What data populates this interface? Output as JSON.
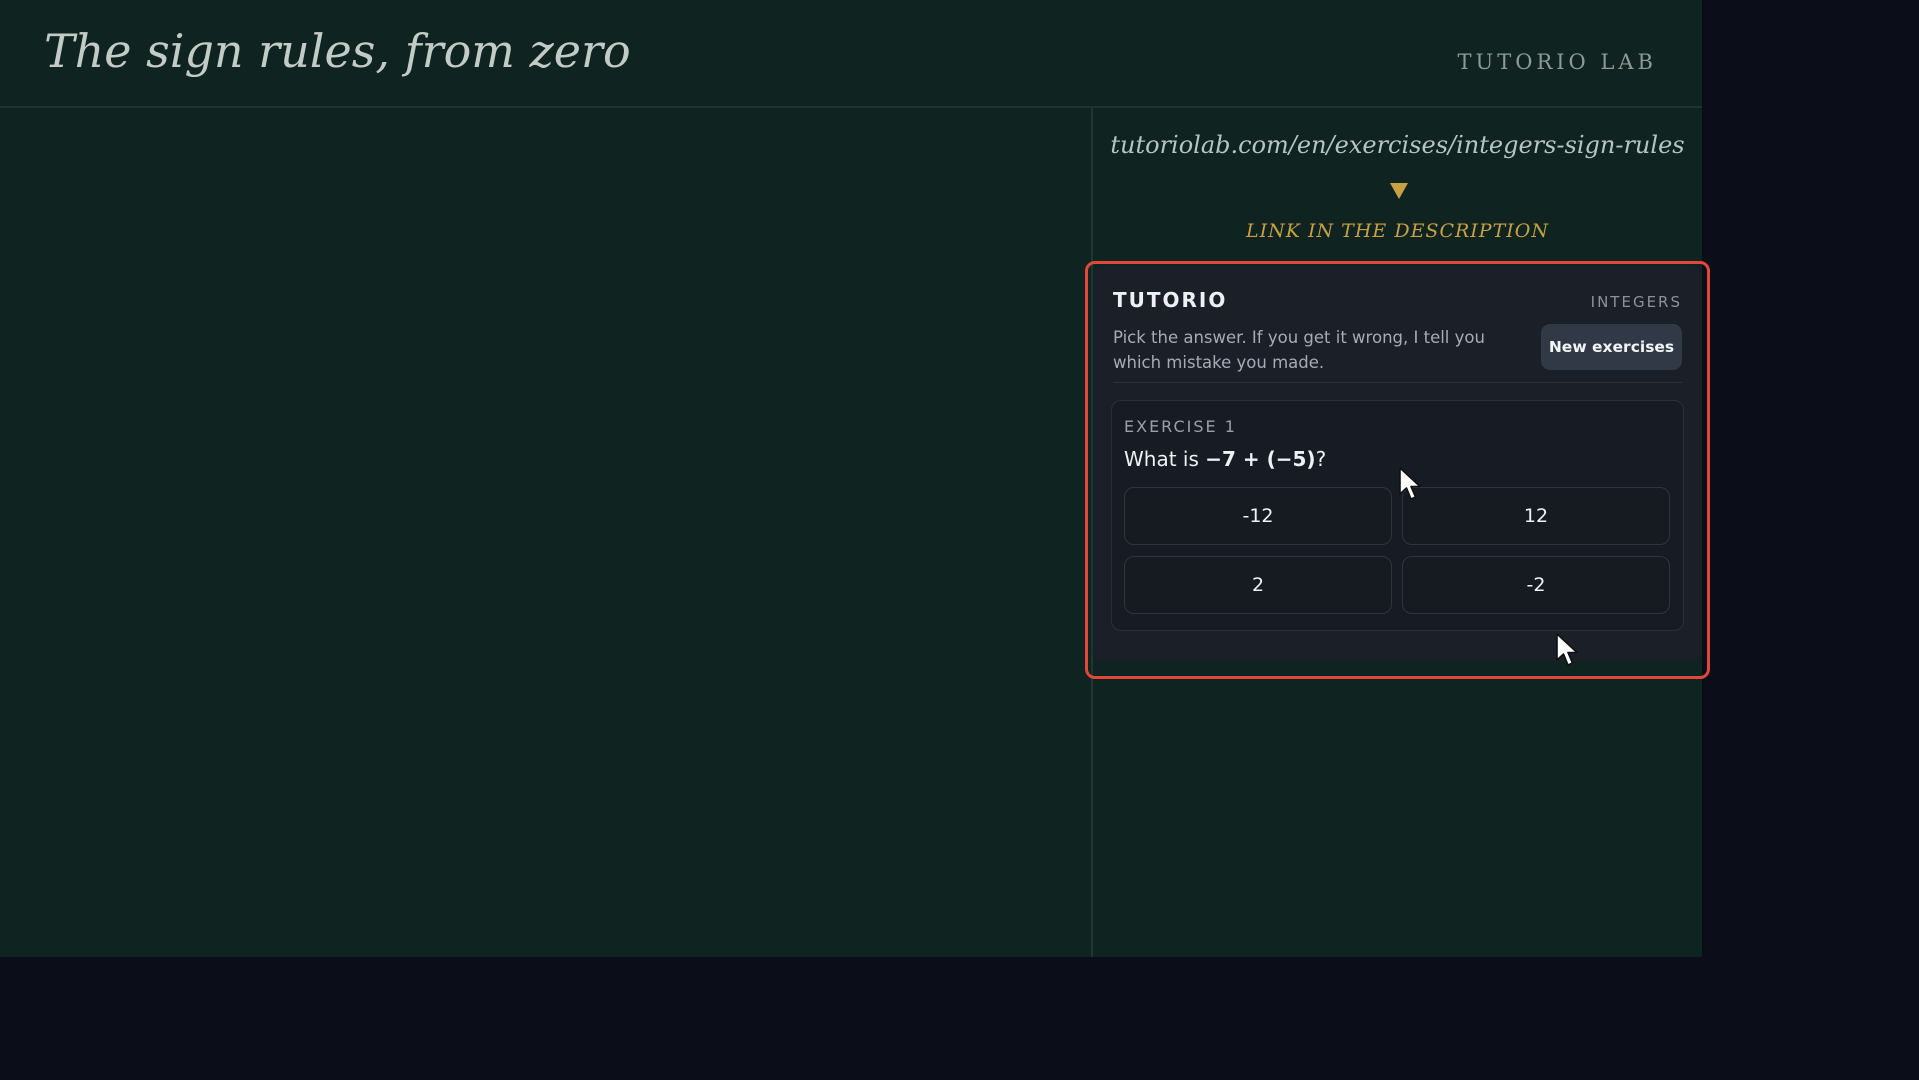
{
  "header": {
    "title": "The sign rules, from zero",
    "brand": "TUTORIO LAB"
  },
  "promo": {
    "url": "tutoriolab.com/en/exercises/integers-sign-rules",
    "cta": "LINK IN THE DESCRIPTION",
    "highlight_color": "#e1473a",
    "accent_color": "#c9a043"
  },
  "widget": {
    "name": "TUTORIO",
    "topic": "INTEGERS",
    "description": "Pick the answer. If you get it wrong, I tell you which mistake you made.",
    "new_button": "New exercises",
    "exercise": {
      "label": "EXERCISE 1",
      "question_prefix": "What is ",
      "question_expr": "−7 + (−5)",
      "question_suffix": "?",
      "choices": [
        "-12",
        "12",
        "2",
        "-2"
      ]
    }
  }
}
